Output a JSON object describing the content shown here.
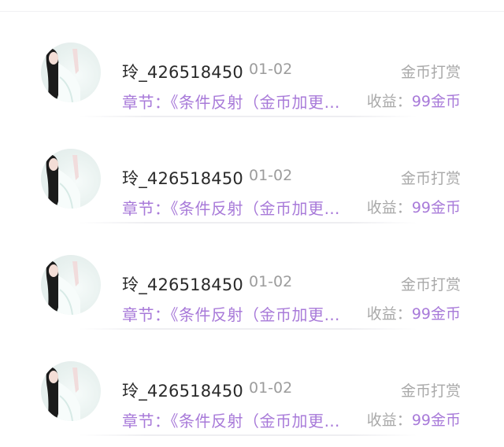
{
  "records": [
    {
      "username": "玲_426518450",
      "date": "01-02",
      "type": "金币打赏",
      "chapter": "章节：《条件反射（金币加更）》",
      "income_label": "收益：",
      "income_amount": "99金币"
    },
    {
      "username": "玲_426518450",
      "date": "01-02",
      "type": "金币打赏",
      "chapter": "章节：《条件反射（金币加更）》",
      "income_label": "收益：",
      "income_amount": "99金币"
    },
    {
      "username": "玲_426518450",
      "date": "01-02",
      "type": "金币打赏",
      "chapter": "章节：《条件反射（金币加更）》",
      "income_label": "收益：",
      "income_amount": "99金币"
    },
    {
      "username": "玲_426518450",
      "date": "01-02",
      "type": "金币打赏",
      "chapter": "章节：《条件反射（金币加更）》",
      "income_label": "收益：",
      "income_amount": "99金币"
    }
  ],
  "colors": {
    "accent": "#a87ad9",
    "muted": "#a9a9a9",
    "text": "#2a2a2a"
  },
  "icons": {
    "avatar": "user-avatar-image"
  }
}
